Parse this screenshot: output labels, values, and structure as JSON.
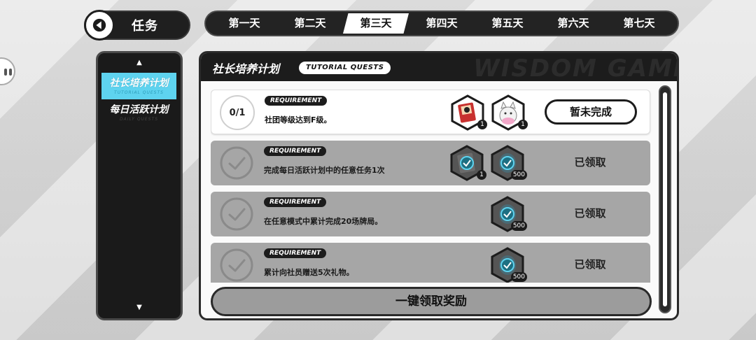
{
  "header": {
    "title": "任务",
    "days": [
      "第一天",
      "第二天",
      "第三天",
      "第四天",
      "第五天",
      "第六天",
      "第七天"
    ],
    "active_day_index": 2
  },
  "sidebar": {
    "items": [
      {
        "label": "社长培养计划",
        "sub": "TUTORIAL QUESTS",
        "active": true
      },
      {
        "label": "每日活跃计划",
        "sub": "DAILY QUESTS",
        "active": false
      }
    ]
  },
  "panel": {
    "title": "社长培养计划",
    "tag": "TUTORIAL QUESTS",
    "watermark": "WISDOM GAME"
  },
  "quests": [
    {
      "state": "open",
      "progress": "0/1",
      "requirement_label": "REQUIREMENT",
      "description": "社团等级达到F级。",
      "rewards": [
        {
          "icon": "card-pack-icon",
          "qty": "1"
        },
        {
          "icon": "cat-character-icon",
          "qty": "1"
        }
      ],
      "status": "暂未完成"
    },
    {
      "state": "claimed",
      "requirement_label": "REQUIREMENT",
      "description": "完成每日活跃计划中的任意任务1次",
      "rewards": [
        {
          "icon": "card-pack-icon",
          "qty": "1"
        },
        {
          "icon": "coin-icon",
          "qty": "500"
        }
      ],
      "status": "已领取"
    },
    {
      "state": "claimed",
      "requirement_label": "REQUIREMENT",
      "description": "在任意模式中累计完成20场牌局。",
      "rewards": [
        {
          "icon": "coin-icon",
          "qty": "500"
        }
      ],
      "status": "已领取"
    },
    {
      "state": "claimed",
      "requirement_label": "REQUIREMENT",
      "description": "累计向社员赠送5次礼物。",
      "rewards": [
        {
          "icon": "coin-icon",
          "qty": "500"
        }
      ],
      "status": "已领取"
    }
  ],
  "claim_all_label": "一键领取奖励",
  "colors": {
    "accent": "#5ed3ef",
    "dark": "#1c1c1c",
    "claimed_row": "#a6a6a6"
  }
}
